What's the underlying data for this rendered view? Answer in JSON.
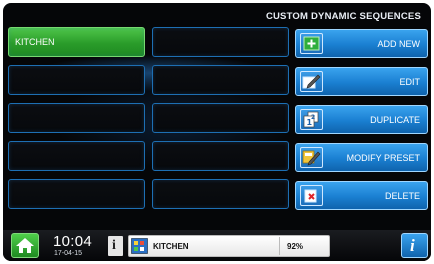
{
  "header": {
    "title": "CUSTOM DYNAMIC SEQUENCES"
  },
  "slots": [
    {
      "label": "KITCHEN",
      "active": true
    },
    {
      "label": "",
      "active": false
    },
    {
      "label": "",
      "active": false
    },
    {
      "label": "",
      "active": false
    },
    {
      "label": "",
      "active": false
    },
    {
      "label": "",
      "active": false
    },
    {
      "label": "",
      "active": false
    },
    {
      "label": "",
      "active": false
    },
    {
      "label": "",
      "active": false
    },
    {
      "label": "",
      "active": false
    }
  ],
  "actions": {
    "add_new": "ADD NEW",
    "edit": "EDIT",
    "duplicate": "DUPLICATE",
    "modify_preset": "MODIFY PRESET",
    "delete": "DELETE"
  },
  "footer": {
    "time": "10:04",
    "date": "17-04-15",
    "info_label": "i",
    "sequence_name": "KITCHEN",
    "level": "92%",
    "help_label": "i"
  },
  "icons": {
    "home": "home-icon",
    "add": "plus-icon",
    "edit": "pencil-icon",
    "duplicate": "duplicate-icon",
    "modify_preset": "modify-preset-icon",
    "delete": "delete-icon",
    "sequence": "sequence-icon"
  },
  "colors": {
    "accent_blue": "#1a7fd1",
    "active_green": "#2a9c2a",
    "background": "#050608"
  }
}
